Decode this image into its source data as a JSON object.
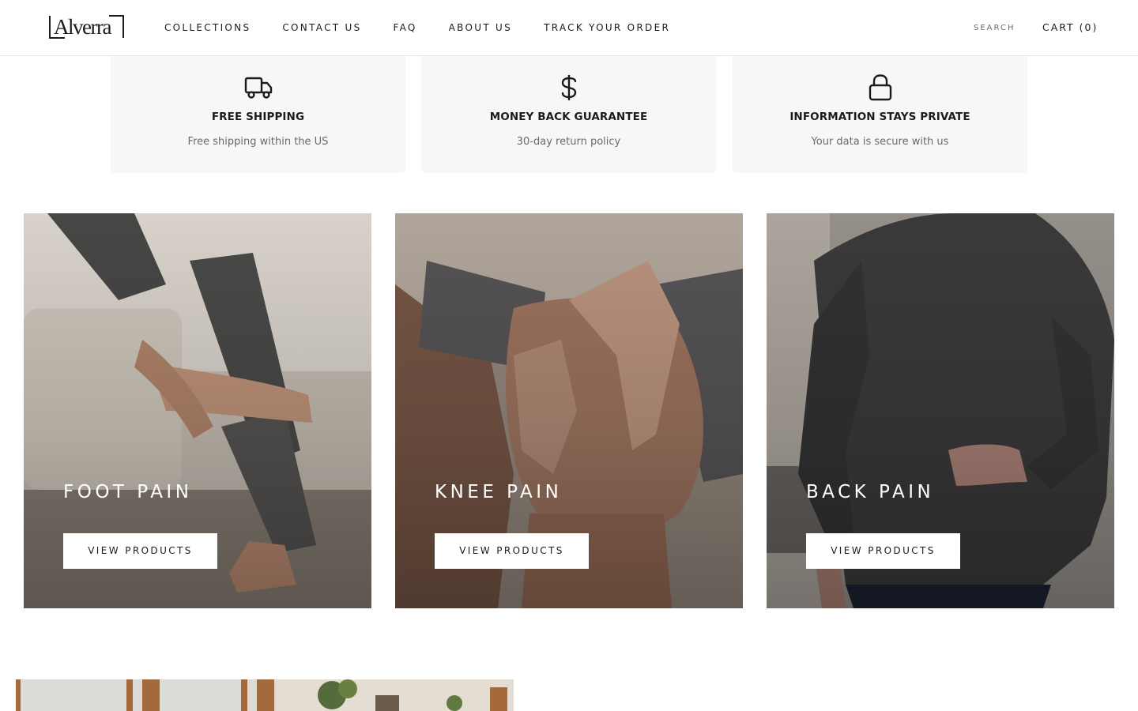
{
  "header": {
    "logo_text": "Alverra",
    "nav": [
      {
        "label": "COLLECTIONS"
      },
      {
        "label": "CONTACT US"
      },
      {
        "label": "FAQ"
      },
      {
        "label": "ABOUT US"
      },
      {
        "label": "TRACK YOUR ORDER"
      }
    ],
    "search_label": "SEARCH",
    "cart_label": "CART (0)"
  },
  "badges": [
    {
      "icon": "truck-icon",
      "title": "FREE SHIPPING",
      "subtitle": "Free shipping within the US"
    },
    {
      "icon": "dollar-icon",
      "title": "MONEY BACK GUARANTEE",
      "subtitle": "30-day return policy"
    },
    {
      "icon": "lock-icon",
      "title": "INFORMATION STAYS PRIVATE",
      "subtitle": "Your data is secure with us"
    }
  ],
  "categories": [
    {
      "title": "FOOT PAIN",
      "button_label": "VIEW PRODUCTS",
      "image": "foot-pain-photo"
    },
    {
      "title": "KNEE PAIN",
      "button_label": "VIEW PRODUCTS",
      "image": "knee-pain-photo"
    },
    {
      "title": "BACK PAIN",
      "button_label": "VIEW PRODUCTS",
      "image": "back-pain-photo"
    }
  ],
  "colors": {
    "text": "#1c1b1b",
    "muted": "#6a6a6a",
    "badge_bg": "#f7f7f7",
    "button_bg": "#ffffff"
  }
}
